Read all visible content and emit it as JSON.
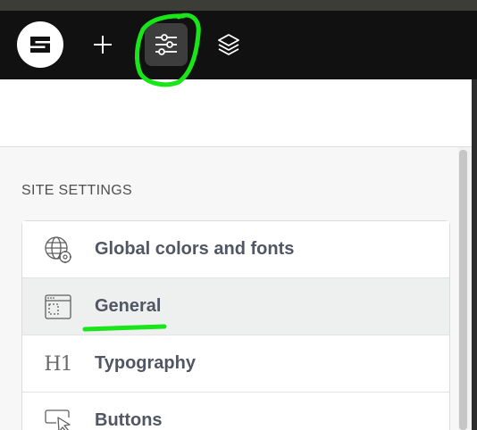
{
  "toolbar": {
    "logo": {
      "letter": "S",
      "icon": "brand-logo-icon"
    },
    "buttons": [
      {
        "name": "add",
        "icon": "plus-icon"
      },
      {
        "name": "site-settings",
        "icon": "sliders-icon",
        "active": true
      },
      {
        "name": "layers",
        "icon": "layers-icon"
      }
    ]
  },
  "panel": {
    "section_title": "SITE SETTINGS",
    "items": [
      {
        "label": "Global colors and fonts",
        "icon": "globe-settings-icon"
      },
      {
        "label": "General",
        "icon": "browser-window-icon",
        "active": true
      },
      {
        "label": "Typography",
        "icon": "h1-icon",
        "glyph": "H1"
      },
      {
        "label": "Buttons",
        "icon": "cursor-click-icon"
      }
    ]
  },
  "annotations": {
    "color": "#19e619",
    "marks": [
      "circle-around-settings-button",
      "underline-under-general"
    ]
  },
  "colors": {
    "toolbar": "#111111",
    "active_button": "#3d3d3d",
    "label": "#505663",
    "active_row": "#eef0ef"
  }
}
